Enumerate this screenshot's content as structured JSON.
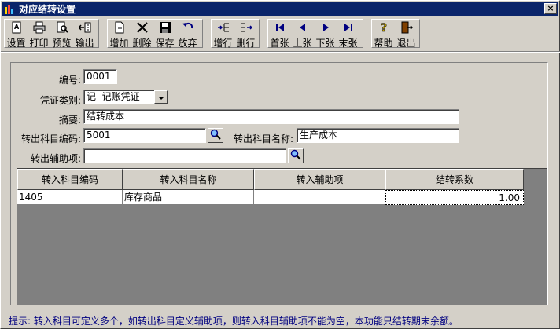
{
  "window": {
    "title": "对应结转设置",
    "close_glyph": "×"
  },
  "toolbar": {
    "buttons": [
      {
        "id": "settings",
        "label": "设置",
        "icon": "page-setup-icon"
      },
      {
        "id": "print",
        "label": "打印",
        "icon": "printer-icon"
      },
      {
        "id": "preview",
        "label": "预览",
        "icon": "preview-icon"
      },
      {
        "id": "export",
        "label": "输出",
        "icon": "export-icon"
      },
      {
        "id": "add",
        "label": "增加",
        "icon": "add-page-icon"
      },
      {
        "id": "delete",
        "label": "删除",
        "icon": "delete-x-icon"
      },
      {
        "id": "save",
        "label": "保存",
        "icon": "floppy-icon"
      },
      {
        "id": "discard",
        "label": "放弃",
        "icon": "undo-icon"
      },
      {
        "id": "add_row",
        "label": "增行",
        "icon": "add-row-icon"
      },
      {
        "id": "delete_row",
        "label": "删行",
        "icon": "delete-row-icon"
      },
      {
        "id": "first",
        "label": "首张",
        "icon": "first-record-icon"
      },
      {
        "id": "prev",
        "label": "上张",
        "icon": "prev-record-icon"
      },
      {
        "id": "next",
        "label": "下张",
        "icon": "next-record-icon"
      },
      {
        "id": "last",
        "label": "末张",
        "icon": "last-record-icon"
      },
      {
        "id": "help",
        "label": "帮助",
        "icon": "help-icon"
      },
      {
        "id": "exit",
        "label": "退出",
        "icon": "exit-door-icon"
      }
    ]
  },
  "form": {
    "number_label": "编号:",
    "number_value": "0001",
    "voucher_type_label": "凭证类别:",
    "voucher_type_value": "记  记账凭证",
    "summary_label": "摘要:",
    "summary_value": "结转成本",
    "out_account_code_label": "转出科目编码:",
    "out_account_code_value": "5001",
    "out_account_name_label": "转出科目名称:",
    "out_account_name_value": "生产成本",
    "out_aux_label": "转出辅助项:",
    "out_aux_value": ""
  },
  "grid": {
    "headers": [
      "转入科目编码",
      "转入科目名称",
      "转入辅助项",
      "结转系数"
    ],
    "rows": [
      [
        "1405",
        "库存商品",
        "",
        "1.00"
      ]
    ]
  },
  "hint": "提示: 转入科目可定义多个，如转出科目定义辅助项，则转入科目辅助项不能为空，本功能只结转期末余额。"
}
